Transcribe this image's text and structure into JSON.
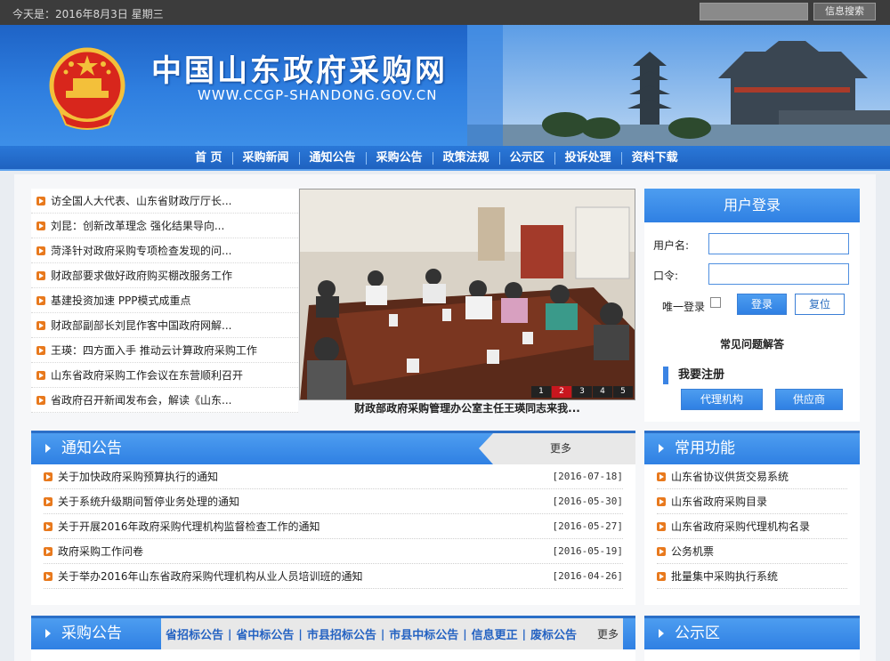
{
  "topbar": {
    "date_text": "今天是：2016年8月3日 星期三",
    "search_placeholder": "",
    "search_button": "信息搜索"
  },
  "banner": {
    "title": "中国山东政府采购网",
    "url": "WWW.CCGP-SHANDONG.GOV.CN"
  },
  "nav": [
    "首 页",
    "采购新闻",
    "通知公告",
    "采购公告",
    "政策法规",
    "公示区",
    "投诉处理",
    "资料下载"
  ],
  "news": [
    "访全国人大代表、山东省财政厅厅长...",
    "刘昆：创新改革理念 强化结果导向...",
    "菏泽针对政府采购专项检查发现的问...",
    "财政部要求做好政府购买棚改服务工作",
    "基建投资加速 PPP模式成重点",
    "财政部副部长刘昆作客中国政府网解...",
    "王瑛：四方面入手 推动云计算政府采购工作",
    "山东省政府采购工作会议在东营顺利召开",
    "省政府召开新闻发布会，解读《山东..."
  ],
  "slideshow": {
    "caption": "财政部政府采购管理办公室主任王瑛同志来我...",
    "pages": [
      "1",
      "2",
      "3",
      "4",
      "5"
    ],
    "active_page": 2
  },
  "login": {
    "title": "用户登录",
    "username_label": "用户名:",
    "password_label": "口令:",
    "unique_login_label": "唯一登录",
    "login_button": "登录",
    "reset_button": "复位",
    "faq": "常见问题解答",
    "register": "我要注册",
    "agency_button": "代理机构",
    "supplier_button": "供应商"
  },
  "notice": {
    "title": "通知公告",
    "more": "更多",
    "items": [
      {
        "title": "关于加快政府采购预算执行的通知",
        "date": "[2016-07-18]"
      },
      {
        "title": "关于系统升级期间暂停业务处理的通知",
        "date": "[2016-05-30]"
      },
      {
        "title": "关于开展2016年政府采购代理机构监督检查工作的通知",
        "date": "[2016-05-27]"
      },
      {
        "title": "政府采购工作问卷",
        "date": "[2016-05-19]"
      },
      {
        "title": "关于举办2016年山东省政府采购代理机构从业人员培训班的通知",
        "date": "[2016-04-26]"
      }
    ]
  },
  "common": {
    "title": "常用功能",
    "items": [
      "山东省协议供货交易系统",
      "山东省政府采购目录",
      "山东省政府采购代理机构名录",
      "公务机票",
      "批量集中采购执行系统"
    ]
  },
  "purchase": {
    "title": "采购公告",
    "tabs": [
      "省招标公告",
      "省中标公告",
      "市县招标公告",
      "市县中标公告",
      "信息更正",
      "废标公告"
    ],
    "more": "更多"
  },
  "publicity": {
    "title": "公示区"
  },
  "colors": {
    "accent_blue": "#2f80e3",
    "bullet_orange": "#e8791d",
    "page_active": "#c8161e"
  }
}
